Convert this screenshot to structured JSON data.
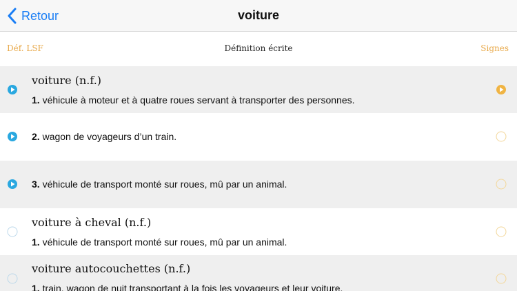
{
  "navbar": {
    "back_label": "Retour",
    "title": "voiture"
  },
  "segments": {
    "left": "Déf. LSF",
    "center": "Définition écrite",
    "right": "Signes"
  },
  "colors": {
    "accent_blue": "#1a7ef5",
    "play_cyan": "#2aa8e0",
    "orange": "#f0b443",
    "outline_blue": "#bcd8ea",
    "outline_orange": "#f3d79a"
  },
  "entries": [
    {
      "headword": "voiture (n.f.)",
      "num": "1.",
      "text": " véhicule à moteur et à quatre roues servant à transporter des personnes.",
      "left_icon": "play-icon",
      "right_icon": "play-orange-icon"
    },
    {
      "headword": "",
      "num": "2.",
      "text": " wagon de voyageurs d’un train.",
      "left_icon": "play-icon",
      "right_icon": "circle-outline-icon"
    },
    {
      "headword": "",
      "num": "3.",
      "text": " véhicule de transport monté sur roues, mû par un animal.",
      "left_icon": "play-icon",
      "right_icon": "circle-outline-icon"
    },
    {
      "headword": "voiture à cheval (n.f.)",
      "num": "1.",
      "text": " véhicule de transport monté sur roues, mû par un animal.",
      "left_icon": "circle-outline-icon",
      "right_icon": "circle-outline-icon"
    },
    {
      "headword": "voiture autocouchettes (n.f.)",
      "num": "1.",
      "text": " train, wagon de nuit transportant à la fois les voyageurs et leur voiture.",
      "left_icon": "circle-outline-icon",
      "right_icon": "circle-outline-icon"
    }
  ]
}
